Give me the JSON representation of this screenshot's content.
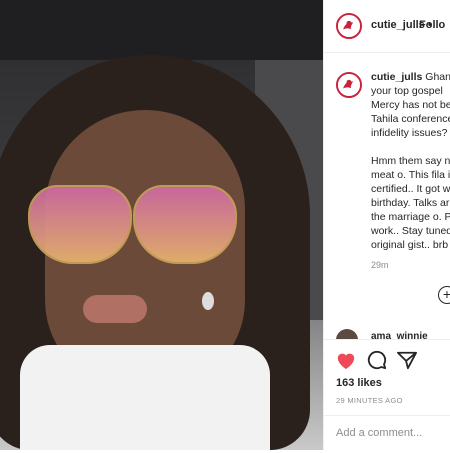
{
  "post": {
    "username": "cutie_julls",
    "separator": "•",
    "follow_label": "Follo",
    "caption_lines": [
      "Ghana",
      "your top gospel",
      "Mercy has not be",
      "Tahila conference",
      "infidelity issues?"
    ],
    "para2_lines": [
      "Hmm them say n",
      "meat o. This fila i",
      "certified.. It got w",
      "birthday. Talks ar",
      "the marriage o. P",
      "work.. Stay tuned",
      "original gist.. brb"
    ],
    "time": "29m",
    "comment_preview_user": "ama_winnie",
    "likes": "163 likes",
    "time_ago": "29 MINUTES AGO",
    "add_comment_placeholder": "Add a comment..."
  },
  "colors": {
    "heart": "#ed4956",
    "avatar_ring": "#c8233b"
  },
  "icons": [
    "heart-icon",
    "comment-icon",
    "share-icon",
    "add-icon"
  ]
}
